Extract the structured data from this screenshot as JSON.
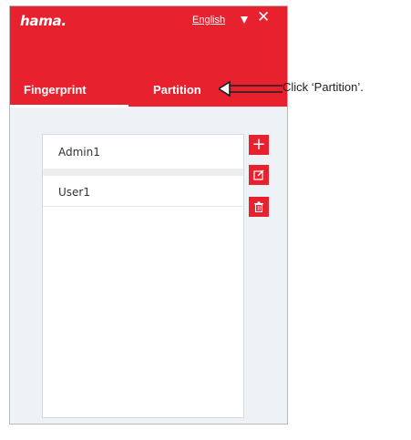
{
  "header": {
    "logo": "hama.",
    "language": "English",
    "close_label": "✕"
  },
  "tabs": [
    {
      "label": "Fingerprint",
      "selected": true
    },
    {
      "label": "Partition",
      "selected": false
    }
  ],
  "users": [
    {
      "name": "Admin1"
    },
    {
      "name": "User1"
    }
  ],
  "actions": {
    "add_label": "+",
    "add_icon": "plus-icon",
    "edit_icon": "edit-icon",
    "delete_icon": "trash-icon"
  },
  "annotation": {
    "text": "Click ‘Partition’."
  },
  "colors": {
    "brand_red": "#e8212f",
    "panel_bg": "#eef2f7"
  }
}
